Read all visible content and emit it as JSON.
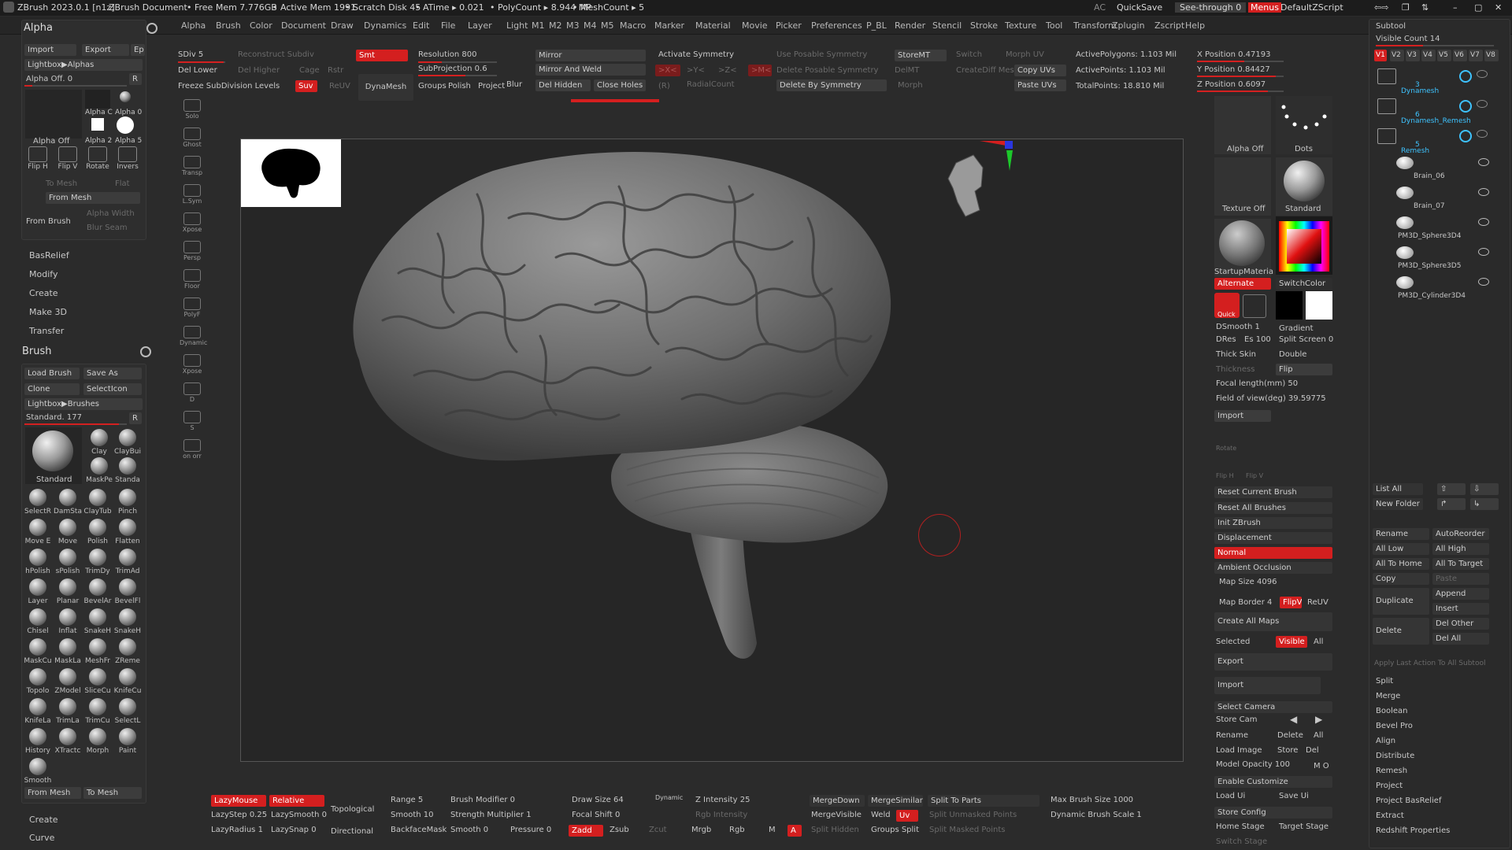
{
  "title_bar": {
    "app": "ZBrush 2023.0.1 [n1z]",
    "doc": "ZBrush Document",
    "free_mem": "• Free Mem 7.776GB",
    "active_mem": "• Active Mem 1991",
    "scratch": "• Scratch Disk 45",
    "atime": "• ATime ▸ 0.021",
    "polycount": "• PolyCount ▸ 8.944 MP",
    "meshcount": "• MeshCount ▸ 5",
    "ac": "AC",
    "quicksave": "QuickSave",
    "see_through": "See-through  0",
    "menus": "Menus",
    "script": "DefaultZScript"
  },
  "menu": [
    "Alpha",
    "Brush",
    "Color",
    "Document",
    "Draw",
    "Dynamics",
    "Edit",
    "File",
    "Layer",
    "Light",
    "M1",
    "M2",
    "M3",
    "M4",
    "M5",
    "Macro",
    "Marker",
    "Material",
    "Movie",
    "Picker",
    "Preferences",
    "P_BL",
    "Render",
    "Stencil",
    "Stroke",
    "Texture",
    "Tool",
    "Transform",
    "Zplugin",
    "Zscript",
    "Help"
  ],
  "top_shelf": {
    "sdiv": "SDiv 5",
    "reconstruct": "Reconstruct Subdiv",
    "smt": "Smt",
    "resolution": "Resolution 800",
    "mirror": "Mirror",
    "activate_symmetry": "Activate Symmetry",
    "use_posable": "Use Posable Symmetry",
    "storemt": "StoreMT",
    "switch": "Switch",
    "morph_uv": "Morph UV",
    "active_polygons": "ActivePolygons: 1.103 Mil",
    "x_position": "X Position 0.47193",
    "del_lower": "Del Lower",
    "del_higher": "Del Higher",
    "cage": "Cage",
    "rstr": "Rstr",
    "subprojection": "SubProjection 0.6",
    "mirror_weld": "Mirror And Weld",
    "sym_x": ">X<",
    "sym_y": ">Y<",
    "sym_z": ">Z<",
    "sym_m": ">M<",
    "delete_posable": "Delete Posable Symmetry",
    "delmt": "DelMT",
    "creatediff": "CreateDiff Mes",
    "copy_uvs": "Copy UVs",
    "active_points": "ActivePoints: 1.103 Mil",
    "y_position": "Y Position 0.84427",
    "freeze_subdiv": "Freeze SubDivision Levels",
    "suv": "Suv",
    "reuv": "ReUV",
    "dynamesh": "DynaMesh",
    "groups": "Groups",
    "polish": "Polish",
    "project": "Project",
    "blur": "Blur",
    "del_hidden": "Del Hidden",
    "close_holes": "Close Holes",
    "r": "(R)",
    "radial_count": "RadialCount",
    "delete_by_symmetry": "Delete By Symmetry",
    "morph": "Morph",
    "paste_uvs": "Paste UVs",
    "total_points": "TotalPoints: 18.810 Mil",
    "z_position": "Z Position 0.6097"
  },
  "alpha_panel": {
    "title": "Alpha",
    "import": "Import",
    "export": "Export",
    "ep": "Ep",
    "lightbox": "Lightbox▶Alphas",
    "alpha_off": "Alpha Off. 0",
    "r": "R",
    "thumbs": [
      "Alpha Off",
      "Alpha C",
      "Alpha 0",
      "Alpha 2",
      "Alpha 5"
    ],
    "tools": [
      "Flip H",
      "Flip V",
      "Rotate",
      "Invers"
    ],
    "to_mesh": "To Mesh",
    "flat": "Flat",
    "from_mesh": "From Mesh",
    "from_brush": "From Brush",
    "alpha_width": "Alpha Width",
    "blur_seam": "Blur Seam"
  },
  "left_menu": [
    "BasRelief",
    "Modify",
    "Create",
    "Make 3D",
    "Transfer"
  ],
  "brush_panel": {
    "title": "Brush",
    "load": "Load Brush",
    "save_as": "Save As",
    "clone": "Clone",
    "select_icon": "SelectIcon",
    "lightbox": "Lightbox▶Brushes",
    "current": "Standard. 177",
    "r": "R",
    "big_label": "Standard",
    "top_cells": [
      "Clay",
      "ClayBui",
      "MaskPe",
      "Standa"
    ],
    "grid": [
      "SelectR",
      "DamSta",
      "ClayTub",
      "Pinch",
      "Move E",
      "Move",
      "Polish",
      "Flatten",
      "hPolish",
      "sPolish",
      "TrimDy",
      "TrimAd",
      "Layer",
      "Planar",
      "BevelAr",
      "BevelFl",
      "Chisel",
      "Inflat",
      "SnakeH",
      "SnakeH",
      "MaskCu",
      "MaskLa",
      "MeshFr",
      "ZReme",
      "Topolo",
      "ZModel",
      "SliceCu",
      "KnifeCu",
      "KnifeLa",
      "TrimLa",
      "TrimCu",
      "SelectL",
      "History",
      "XTractc",
      "Morph",
      "Paint",
      "Smooth"
    ],
    "from_mesh": "From Mesh",
    "to_mesh": "To Mesh",
    "bottom": [
      "Create",
      "Curve"
    ]
  },
  "side_shelf": [
    "Solo",
    "Ghost",
    "Transp",
    "L.Sym",
    "Xpose",
    "Persp",
    "Floor",
    "PolyF",
    "Dynamic",
    "Xpose",
    "D",
    "S",
    "on orr"
  ],
  "viewport": {
    "brain_alt": "brain-mesh"
  },
  "right_panel": {
    "alpha_off": "Alpha Off",
    "dots": "Dots",
    "texture_off": "Texture Off",
    "standard": "Standard",
    "startup_material": "StartupMateria",
    "alternate": "Alternate",
    "switch_color": "SwitchColor",
    "quick": "Quick",
    "dsmooth": "DSmooth 1",
    "gradient": "Gradient",
    "dres": "DRes",
    "es": "Es 100",
    "split_screen": "Split Screen 0",
    "thick_skin": "Thick Skin",
    "double": "Double",
    "thickness": "Thickness",
    "flip": "Flip",
    "focal_length": "Focal length(mm) 50",
    "fov": "Field of view(deg) 39.59775",
    "import": "Import",
    "rotate": "Rotate",
    "flip_h": "Flip H",
    "flip_v": "Flip V",
    "reset_current_brush": "Reset Current Brush",
    "reset_all_brushes": "Reset All Brushes",
    "init_zbrush": "Init ZBrush",
    "displacement": "Displacement",
    "normal": "Normal",
    "ambient_occlusion": "Ambient Occlusion",
    "map_size": "Map Size 4096",
    "map_border": "Map Border 4",
    "flipv": "FlipV",
    "reuv": "ReUV",
    "create_all_maps": "Create All Maps",
    "selected": "Selected",
    "visible": "Visible",
    "all": "All",
    "export": "Export",
    "import2": "Import",
    "select_camera": "Select Camera",
    "store_cam": "Store Cam",
    "rename": "Rename",
    "delete": "Delete",
    "all2": "All",
    "load_image": "Load Image",
    "store": "Store",
    "del": "Del",
    "model_opacity": "Model Opacity 100",
    "mo": "M O",
    "enable_customize": "Enable Customize",
    "load_ui": "Load Ui",
    "save_ui": "Save Ui",
    "store_config": "Store Config",
    "home_stage": "Home Stage",
    "target_stage": "Target Stage",
    "switch_stage": "Switch Stage"
  },
  "subtool": {
    "title": "Subtool",
    "visible_count": "Visible Count 14",
    "versions": [
      "V1",
      "V2",
      "V3",
      "V4",
      "V5",
      "V6",
      "V7",
      "V8"
    ],
    "folders": [
      {
        "n": "3",
        "name": "Dynamesh"
      },
      {
        "n": "6",
        "name": "Dynamesh_Remesh"
      },
      {
        "n": "5",
        "name": "Remesh"
      }
    ],
    "items": [
      "Brain_06",
      "Brain_07",
      "PM3D_Sphere3D4",
      "PM3D_Sphere3D5",
      "PM3D_Cylinder3D4"
    ],
    "list_all": "List All",
    "new_folder": "New Folder",
    "rename": "Rename",
    "autoreorder": "AutoReorder",
    "all_low": "All Low",
    "all_high": "All High",
    "all_to_home": "All To Home",
    "all_to_target": "All To Target",
    "copy": "Copy",
    "paste": "Paste",
    "duplicate": "Duplicate",
    "append": "Append",
    "insert": "Insert",
    "delete": "Delete",
    "del_other": "Del Other",
    "del_all": "Del All",
    "apply_last": "Apply Last Action To All Subtool",
    "menu": [
      "Split",
      "Merge",
      "Boolean",
      "Bevel Pro",
      "Align",
      "Distribute",
      "Remesh",
      "Project",
      "Project BasRelief",
      "Extract",
      "Redshift Properties"
    ]
  },
  "bottom_shelf": {
    "lazymouse": "LazyMouse",
    "relative": "Relative",
    "lazystep": "LazyStep 0.25",
    "lazysmooth": "LazySmooth 0",
    "lazyradius": "LazyRadius 1",
    "lazysnap": "LazySnap 0",
    "topological": "Topological",
    "directional": "Directional",
    "range": "Range 5",
    "smooth": "Smooth 10",
    "backfacemask": "BackfaceMask",
    "brush_modifier": "Brush Modifier 0",
    "strength_multiplier": "Strength Multiplier 1",
    "smooth0": "Smooth 0",
    "pressure": "Pressure 0",
    "draw_size": "Draw Size 64",
    "dynamic": "Dynamic",
    "focal_shift": "Focal Shift 0",
    "zadd": "Zadd",
    "zsub": "Zsub",
    "zcut": "Zcut",
    "z_intensity": "Z Intensity 25",
    "rgb_intensity": "Rgb Intensity",
    "mrgb": "Mrgb",
    "rgb": "Rgb",
    "m": "M",
    "a": "A",
    "mergedown": "MergeDown",
    "mergesimilar": "MergeSimilar",
    "mergevisible": "MergeVisible",
    "weld": "Weld",
    "uv": "Uv",
    "split_hidden": "Split Hidden",
    "groups_split": "Groups Split",
    "split_to_parts": "Split To Parts",
    "split_unmasked": "Split Unmasked Points",
    "split_masked": "Split Masked Points",
    "max_brush_size": "Max Brush Size 1000",
    "dynamic_brush_scale": "Dynamic Brush Scale 1"
  },
  "colors": {
    "accent": "#d41f1f",
    "panel": "#2e2e2e",
    "bg": "#2b2b2b"
  }
}
